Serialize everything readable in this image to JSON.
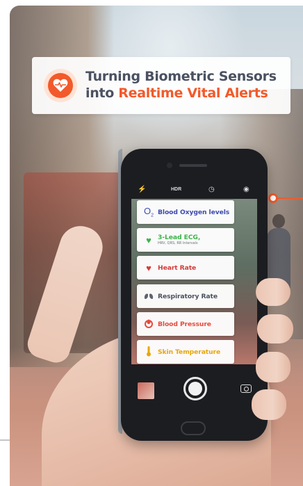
{
  "banner": {
    "line1": "Turning Biometric Sensors",
    "line2_prefix": "into ",
    "line2_accent": "Realtime Vital Alerts",
    "icon": "heart-pulse-icon",
    "accent_color": "#f25a2b"
  },
  "camera": {
    "top_icons": [
      "flash-off-icon",
      "HDR",
      "timer-icon",
      "live-photo-icon"
    ],
    "hdr_label": "HDR"
  },
  "metrics": [
    {
      "icon": "oxygen-icon",
      "label": "Blood Oxygen levels",
      "sublabel": "",
      "color": "#3d4bb0"
    },
    {
      "icon": "heart-ecg-icon",
      "label": "3-Lead ECG,",
      "sublabel": "HRV, QRS, RR Intervals",
      "color": "#3fb24b"
    },
    {
      "icon": "heart-icon",
      "label": "Heart Rate",
      "sublabel": "",
      "color": "#d73a39"
    },
    {
      "icon": "lungs-icon",
      "label": "Respiratory Rate",
      "sublabel": "",
      "color": "#4a5161"
    },
    {
      "icon": "blood-pressure-icon",
      "label": "Blood Pressure",
      "sublabel": "",
      "color": "#e84a3c"
    },
    {
      "icon": "thermometer-icon",
      "label": "Skin Temperature",
      "sublabel": "",
      "color": "#e6a70b"
    }
  ]
}
